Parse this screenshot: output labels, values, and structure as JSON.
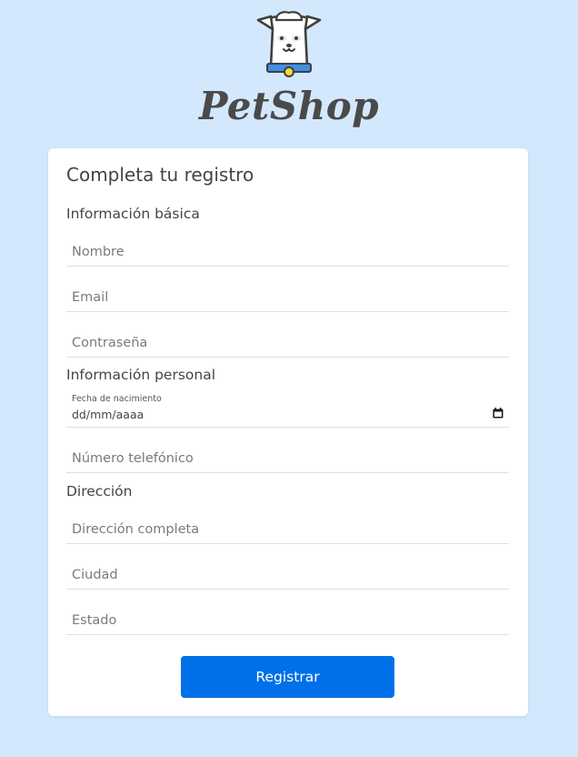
{
  "brand": {
    "name": "PetShop",
    "logo_icon": "dog-mascot-icon"
  },
  "form": {
    "title": "Completa tu registro",
    "sections": {
      "basic": "Información básica",
      "personal": "Información personal",
      "address": "Dirección"
    },
    "fields": {
      "nombre": {
        "placeholder": "Nombre",
        "value": ""
      },
      "email": {
        "placeholder": "Email",
        "value": ""
      },
      "contrasena": {
        "placeholder": "Contraseña",
        "value": ""
      },
      "fecha": {
        "label": "Fecha de nacimiento",
        "value": "dd/mm/aaaa",
        "icon": "calendar-icon"
      },
      "telefono": {
        "placeholder": "Número telefónico",
        "value": ""
      },
      "direccion": {
        "placeholder": "Dirección completa",
        "value": ""
      },
      "ciudad": {
        "placeholder": "Ciudad",
        "value": ""
      },
      "estado": {
        "placeholder": "Estado",
        "value": ""
      }
    },
    "submit_label": "Registrar"
  },
  "colors": {
    "background": "#d4e8fd",
    "card": "#ffffff",
    "accent": "#0070e8",
    "field_underline": "#cfe4f6",
    "logo_collar": "#3f8fe6",
    "logo_tag": "#f5d83a"
  }
}
